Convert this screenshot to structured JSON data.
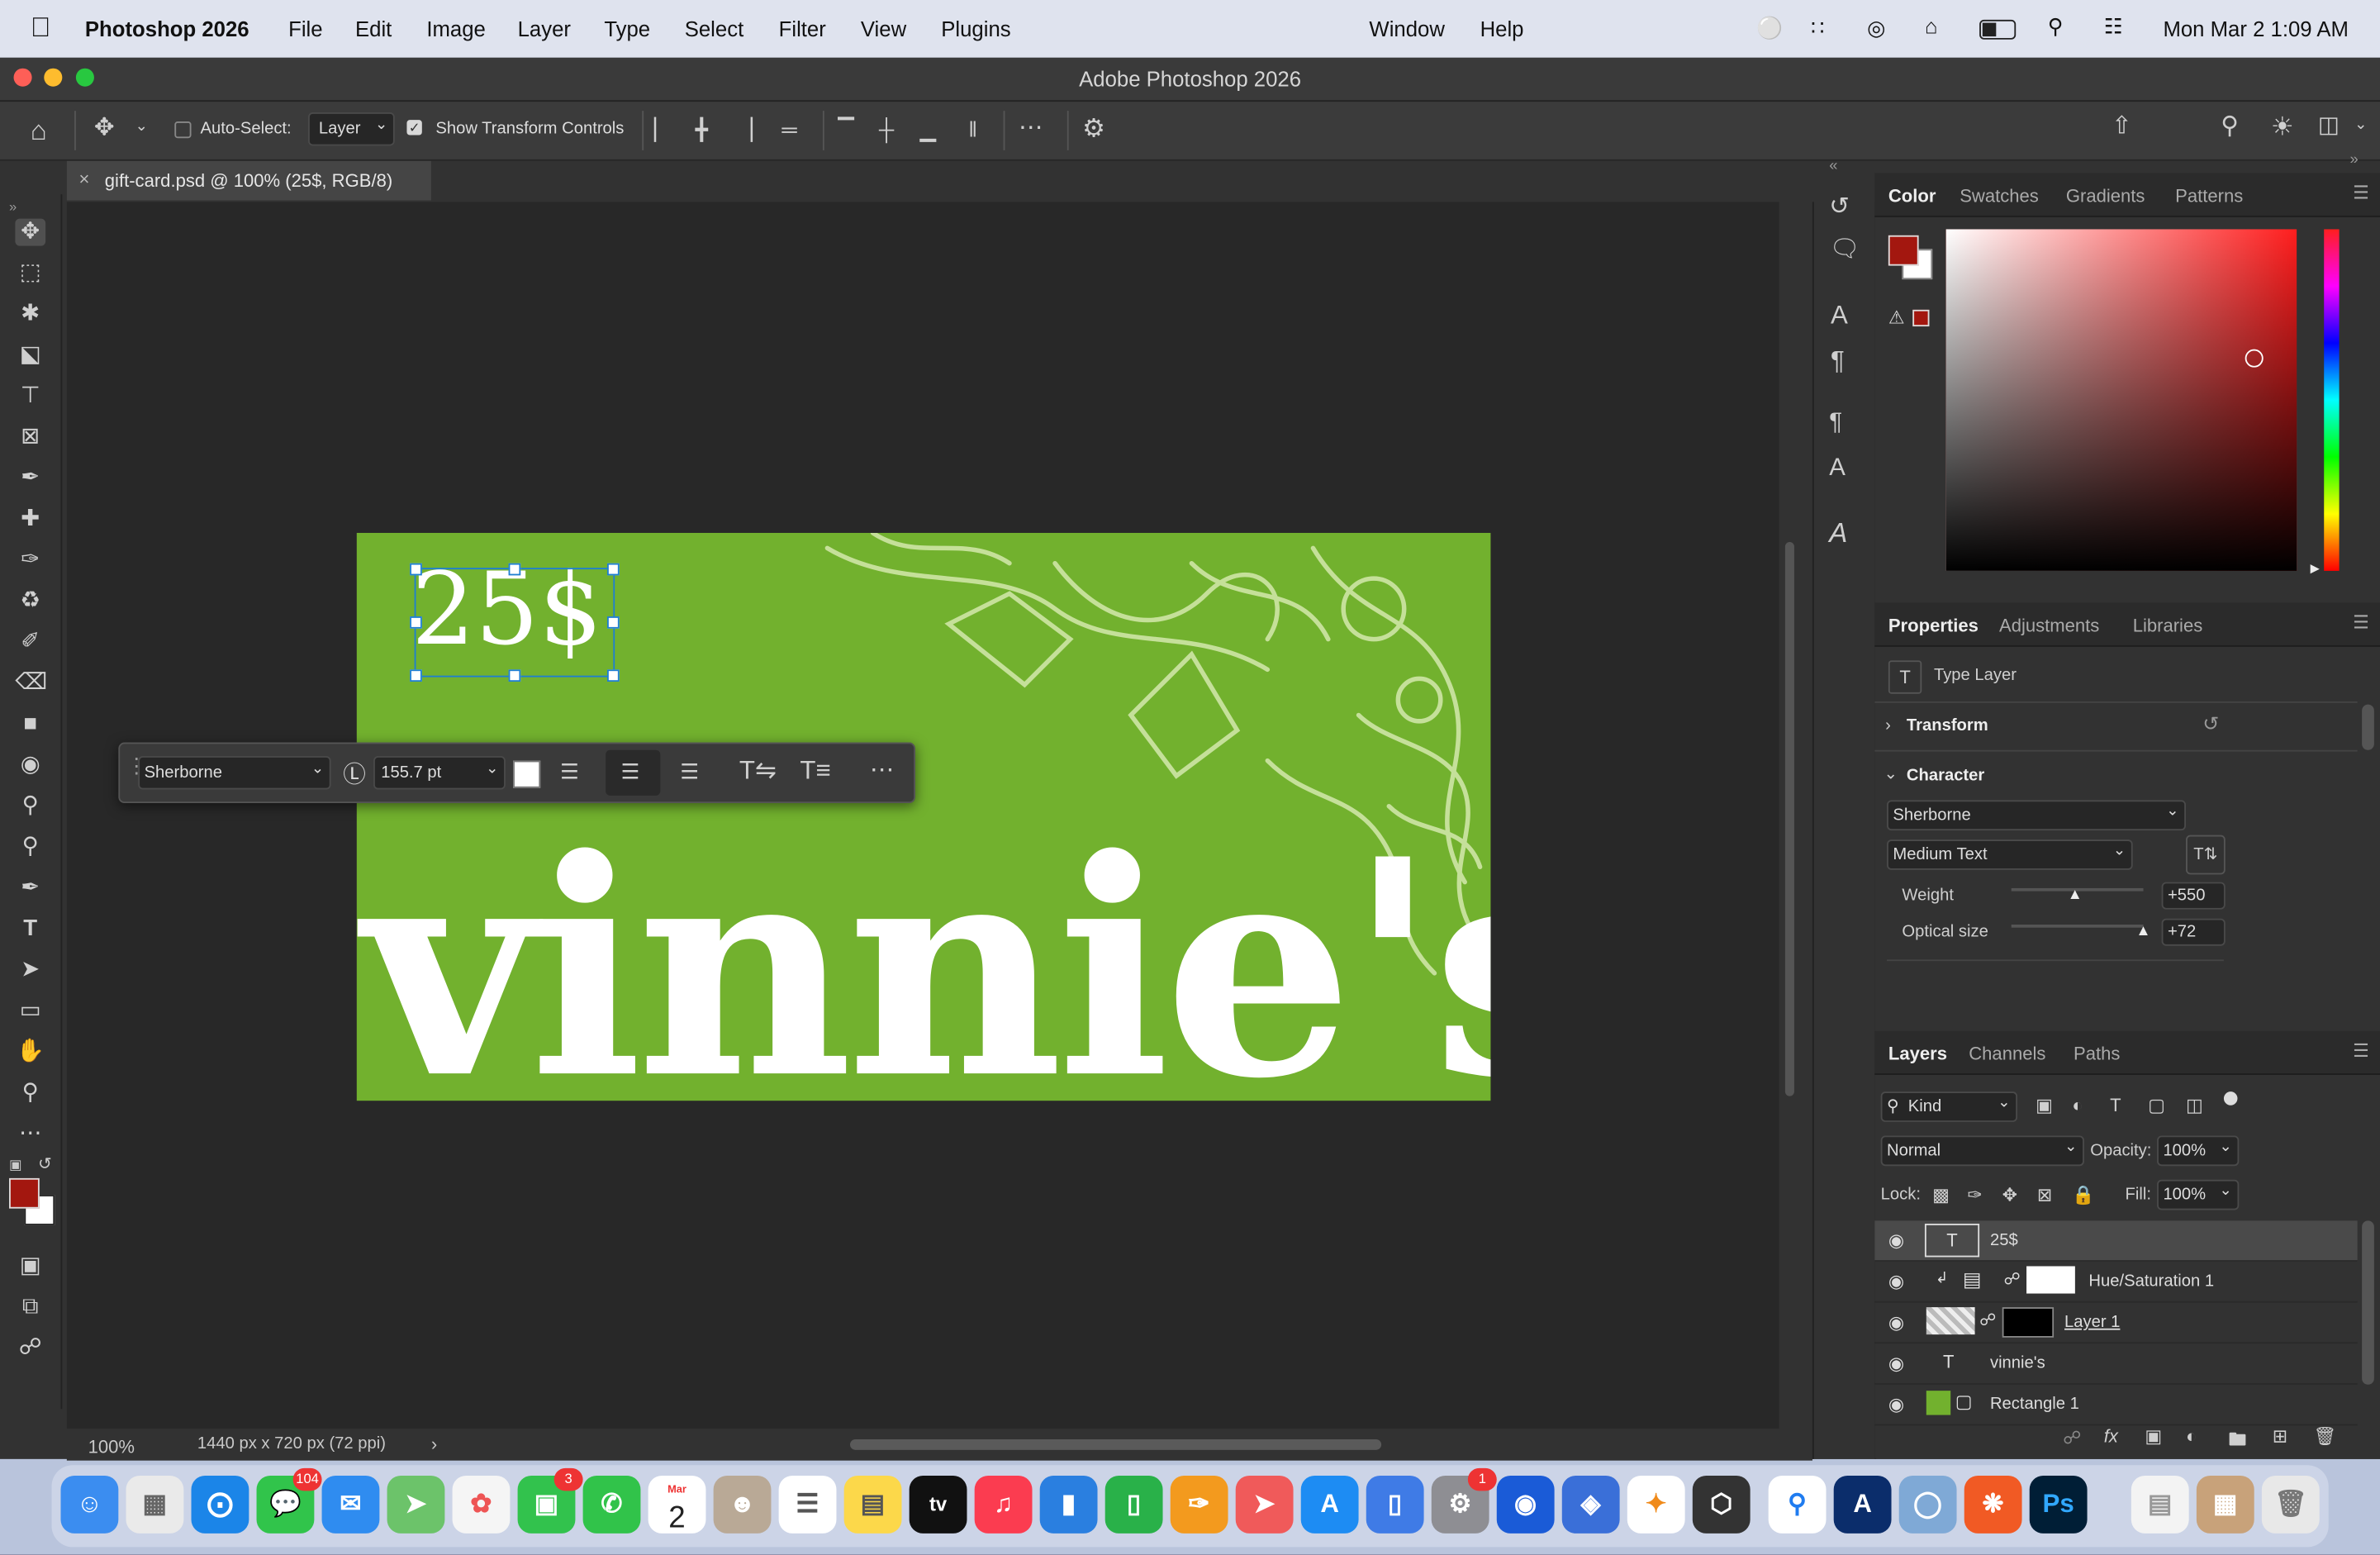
{
  "menubar": {
    "app_name": "Photoshop 2026",
    "items": [
      "File",
      "Edit",
      "Image",
      "Layer",
      "Type",
      "Select",
      "Filter",
      "View",
      "Plugins",
      "Window",
      "Help"
    ],
    "clock": "Mon Mar 2  1:09 AM"
  },
  "window": {
    "title": "Adobe Photoshop 2026"
  },
  "options_bar": {
    "auto_select_label": "Auto-Select:",
    "auto_select_value": "Layer",
    "show_transform_label": "Show Transform Controls"
  },
  "document": {
    "tab_title": "gift-card.psd @ 100% (25$, RGB/8)",
    "price_text": "25$",
    "brand_text": "vinnie's",
    "artboard_color": "#72b12e"
  },
  "floating_toolbar": {
    "font": "Sherborne",
    "size": "155.7 pt"
  },
  "status": {
    "zoom": "100%",
    "dimensions": "1440 px x 720 px (72 ppi)"
  },
  "color_panel": {
    "tabs": [
      "Color",
      "Swatches",
      "Gradients",
      "Patterns"
    ],
    "foreground": "#a3170f",
    "hue": "#ff1e1e"
  },
  "properties_panel": {
    "tabs": [
      "Properties",
      "Adjustments",
      "Libraries"
    ],
    "layer_type": "Type Layer",
    "transform_label": "Transform",
    "character_label": "Character",
    "font_family": "Sherborne",
    "font_style": "Medium Text",
    "weight_label": "Weight",
    "weight_value": "+550",
    "optical_label": "Optical size",
    "optical_value": "+72"
  },
  "layers_panel": {
    "tabs": [
      "Layers",
      "Channels",
      "Paths"
    ],
    "filter": "Kind",
    "blend_mode": "Normal",
    "opacity_label": "Opacity:",
    "opacity": "100%",
    "lock_label": "Lock:",
    "fill_label": "Fill:",
    "fill": "100%",
    "layers": [
      {
        "name": "25$",
        "kind": "type"
      },
      {
        "name": "Hue/Saturation 1",
        "kind": "adjustment"
      },
      {
        "name": "Layer 1",
        "kind": "pixel"
      },
      {
        "name": "vinnie's",
        "kind": "type"
      },
      {
        "name": "Rectangle 1",
        "kind": "shape"
      }
    ]
  },
  "dock": {
    "messages_badge": "104",
    "facetime_badge": "3",
    "calendar_month": "Mar",
    "calendar_day": "2",
    "settings_badge": "1"
  }
}
